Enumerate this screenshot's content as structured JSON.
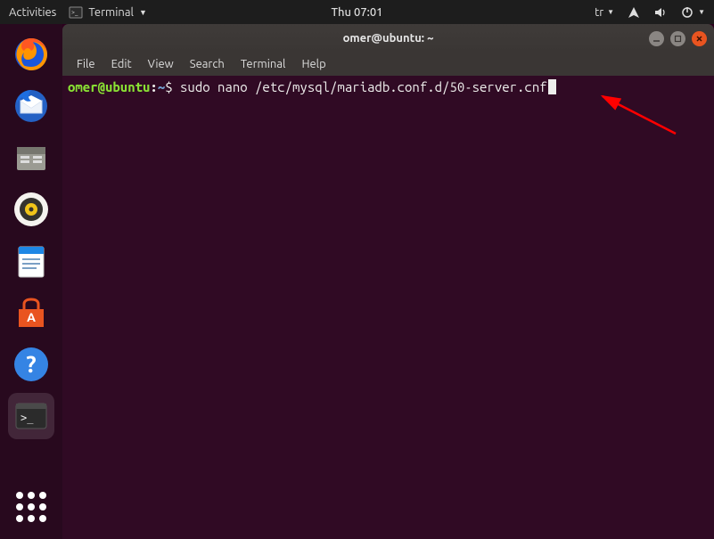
{
  "topbar": {
    "activities": "Activities",
    "app_name": "Terminal",
    "clock": "Thu 07:01",
    "input_source": "tr"
  },
  "launcher": {
    "items": [
      "firefox-icon",
      "thunderbird-icon",
      "files-icon",
      "rhythmbox-icon",
      "writer-icon",
      "software-icon",
      "help-icon",
      "terminal-icon"
    ]
  },
  "window": {
    "title": "omer@ubuntu: ~"
  },
  "menubar": {
    "items": [
      "File",
      "Edit",
      "View",
      "Search",
      "Terminal",
      "Help"
    ]
  },
  "terminal": {
    "prompt_user": "omer@ubuntu",
    "prompt_colon": ":",
    "prompt_path": "~",
    "prompt_dollar": "$ ",
    "command": "sudo nano /etc/mysql/mariadb.conf.d/50-server.cnf"
  }
}
